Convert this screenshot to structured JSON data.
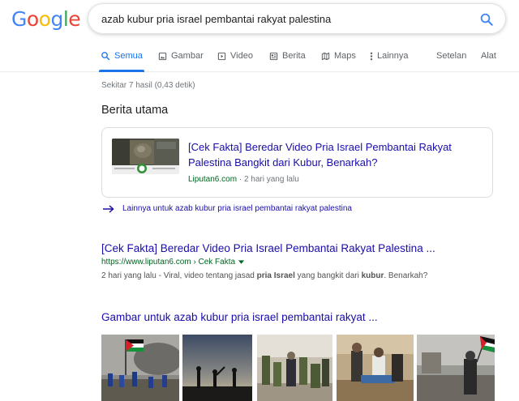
{
  "logo": {
    "letters": [
      "G",
      "o",
      "o",
      "g",
      "l",
      "e"
    ],
    "colors": [
      "#4285f4",
      "#ea4335",
      "#fbbc05",
      "#4285f4",
      "#34a853",
      "#ea4335"
    ]
  },
  "search": {
    "query": "azab kubur pria israel pembantai rakyat palestina"
  },
  "tabs": [
    {
      "label": "Semua",
      "icon": "search-icon",
      "active": true
    },
    {
      "label": "Gambar",
      "icon": "image-icon"
    },
    {
      "label": "Video",
      "icon": "video-icon"
    },
    {
      "label": "Berita",
      "icon": "news-icon"
    },
    {
      "label": "Maps",
      "icon": "map-icon"
    },
    {
      "label": "Lainnya",
      "icon": "more-vert-icon"
    },
    {
      "label": "Setelan"
    },
    {
      "label": "Alat"
    }
  ],
  "result_stats": "Sekitar 7 hasil (0,43 detik)",
  "top_stories": {
    "heading": "Berita utama",
    "card": {
      "title": "[Cek Fakta] Beredar Video Pria Israel Pembantai Rakyat Palestina Bangkit dari Kubur, Benarkah?",
      "source": "Liputan6.com",
      "separator": " · ",
      "time": "2 hari yang lalu"
    },
    "more_link": "Lainnya untuk azab kubur pria israel pembantai rakyat palestina"
  },
  "result": {
    "title": "[Cek Fakta] Beredar Video Pria Israel Pembantai Rakyat Palestina ...",
    "url": "https://www.liputan6.com › Cek Fakta",
    "snippet": {
      "pre": "2 hari yang lalu - Viral, video tentang jasad ",
      "bold1": "pria Israel",
      "mid": " yang bangkit dari ",
      "bold2": "kubur",
      "post": ". Benarkah?"
    }
  },
  "images": {
    "heading": "Gambar untuk azab kubur pria israel pembantai rakyat ..."
  },
  "colors": {
    "link": "#1a0dab",
    "url_green": "#006621",
    "accent": "#1a73e8",
    "meta_gray": "#70757a"
  }
}
